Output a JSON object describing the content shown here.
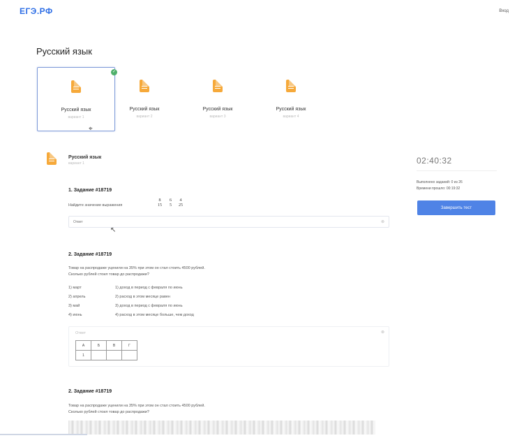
{
  "header": {
    "logo": "ЕГЭ.РФ",
    "login": "Вход"
  },
  "page": {
    "title": "Русский язык"
  },
  "cards": [
    {
      "label": "Русский язык",
      "sub": "вариант 1",
      "selected": true
    },
    {
      "label": "Русский язык",
      "sub": "вариант 2",
      "selected": false
    },
    {
      "label": "Русский язык",
      "sub": "вариант 3",
      "selected": false
    },
    {
      "label": "Русский язык",
      "sub": "вариант 4",
      "selected": false
    }
  ],
  "subject": {
    "title": "Русский язык",
    "sub": "вариант 1"
  },
  "sidebar": {
    "timer": "02:40:32",
    "stats": [
      "Выполнено заданий: 0 из 26",
      "Времени прошло: 00:19:32"
    ],
    "finish_label": "Завершить тест"
  },
  "tasks": [
    {
      "title": "1. Задание #18719",
      "prompt": "Найдите значение выражения",
      "fractions": [
        {
          "num": "8",
          "den": "15"
        },
        {
          "num": "6",
          "den": "5"
        },
        {
          "num": "4",
          "den": "25"
        }
      ],
      "placeholder": "Ответ"
    },
    {
      "title": "2. Задание #18719",
      "text_lines": [
        "Товар на распродаже уценили на 35% при этом он стал стоить 4500 рублей.",
        "Сколько рублей стоил товар до распродажи?"
      ],
      "left_items": [
        "1) март",
        "2) апрель",
        "3) май",
        "4) июнь"
      ],
      "right_items": [
        "1) доход в период с февраля по июнь",
        "2) расход в этом месяце равен",
        "3) доход в период с февраля по июнь",
        "4) расход в этом месяце больше, чем доход"
      ],
      "placeholder": "Ответ",
      "grid_headers": [
        "А",
        "Б",
        "В",
        "Г"
      ],
      "grid_values": [
        "1",
        "",
        "",
        ""
      ]
    },
    {
      "title": "2. Задание #18719",
      "text_lines": [
        "Товар на распродаже уценили на 35% при этом он стал стоить 4500 рублей.",
        "Сколько рублей стоил товар до распродажи?"
      ]
    }
  ]
}
